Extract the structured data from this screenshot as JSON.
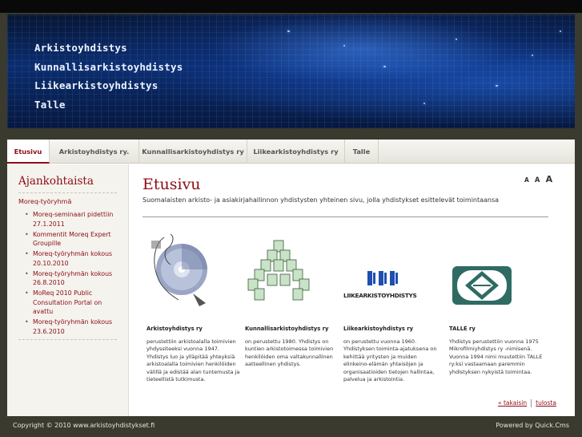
{
  "banner": {
    "items": [
      "Arkistoyhdistys",
      "Kunnallisarkistoyhdistys",
      "Liikearkistoyhdistys",
      "Talle"
    ]
  },
  "nav": {
    "tabs": [
      "Etusivu",
      "Arkistoyhdistys ry.",
      "Kunnallisarkistoyhdistys ry",
      "Liikearkistoyhdistys ry",
      "Talle"
    ],
    "active": "Etusivu"
  },
  "sidebar": {
    "title": "Ajankohtaista",
    "category": "Moreq-työryhmä",
    "items": [
      "Moreq-seminaari pidettiin 27.1.2011",
      "Kommentit Moreq Expert Groupille",
      "Moreq-työryhmän kokous 20.10.2010",
      "Moreq-työryhmän kokous 26.8.2010",
      "MoReq 2010 Public Consultation Portal on avattu",
      "Moreq-työryhmän kokous 23.6.2010"
    ]
  },
  "fontsizer": [
    "A",
    "A",
    "A"
  ],
  "main": {
    "title": "Etusivu",
    "lead": "Suomalaisten arkisto- ja asiakirjahallinnon yhdistysten yhteinen sivu, jolla yhdistykset esittelevät toimintaansa",
    "columns": [
      {
        "name": "Arkistoyhdistys ry",
        "desc": "perustettiin arkistoalalla toimivien yhdyssiteeksi vuonna 1947. Yhdistys luo ja ylläpitää yhteyksiä arkistoalalla toimivien henkilöiden välillä ja edistää alan tuntemusta ja tieteellistä tutkimusta."
      },
      {
        "name": "Kunnallisarkistoyhdistys ry",
        "desc": "on perustettu 1980. Yhdistys on kuntien arkistotoimessa toimivien henkilöiden oma valtakunnallinen aatteellinen yhdistys."
      },
      {
        "name": "Liikearkistoyhdistys ry",
        "logo_text": "LIIKEARKISTOYHDISTYS",
        "desc": "on perustettu vuonna 1960. Yhdistyksen toiminta-ajatuksena on kehittää yritysten ja muiden elinkeino-elämän yhteisöjen ja organisaatioiden tietojen hallintaa, palvelua ja arkistointia."
      },
      {
        "name": "TALLE ry",
        "desc": "Yhdistys perustettiin vuonna 1975 Mikrofilmiyhdistys ry -nimisenä. Vuonna 1994 nimi muutettiin TALLE ry:ksi vastaamaan paremmin yhdistyksen nykyistä toimintaa."
      }
    ],
    "back_label": "« takaisin",
    "print_label": "tulosta"
  },
  "footer": {
    "copyright": "Copyright © 2010 www.arkistoyhdistykset.fi",
    "powered": "Powered by Quick.Cms"
  },
  "colors": {
    "accent": "#8b0c16",
    "frame": "#3a3a2e",
    "talle_teal": "#2f6b63"
  },
  "icons": [
    "cd-face-logo",
    "stacked-documents-logo",
    "liike-bars-logo",
    "talle-diamond-logo"
  ]
}
